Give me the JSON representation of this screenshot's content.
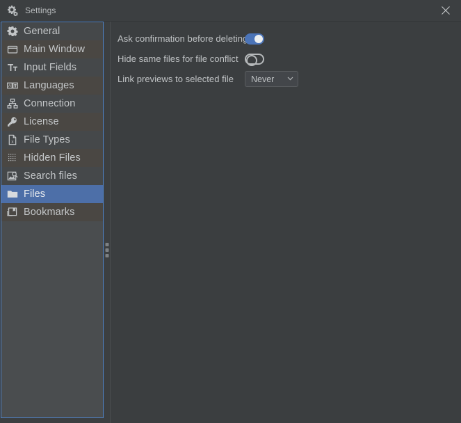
{
  "window": {
    "title": "Settings",
    "icon": "settings-gears-icon",
    "close_label": "×",
    "accent_color": "#4f81c4",
    "background_color": "#3c3f41",
    "content_background_color": "#3b3e40",
    "selection_color": "#4d6fa8",
    "text_color": "#c3c6c8"
  },
  "sidebar": {
    "items": [
      {
        "label": "General",
        "icon": "gear-icon",
        "selected": false
      },
      {
        "label": "Main Window",
        "icon": "window-icon",
        "selected": false
      },
      {
        "label": "Input Fields",
        "icon": "text-cursor-icon",
        "selected": false
      },
      {
        "label": "Languages",
        "icon": "languages-icon",
        "selected": false
      },
      {
        "label": "Connection",
        "icon": "network-icon",
        "selected": false
      },
      {
        "label": "License",
        "icon": "key-icon",
        "selected": false
      },
      {
        "label": "File Types",
        "icon": "file-x-icon",
        "selected": false
      },
      {
        "label": "Hidden Files",
        "icon": "dotted-grid-icon",
        "selected": false
      },
      {
        "label": "Search files",
        "icon": "image-search-icon",
        "selected": false
      },
      {
        "label": "Files",
        "icon": "folder-icon",
        "selected": true
      },
      {
        "label": "Bookmarks",
        "icon": "bookmarks-icon",
        "selected": false
      }
    ]
  },
  "splitter": {
    "icon": "drag-grip-icon"
  },
  "settings": {
    "rows": [
      {
        "label": "Ask confirmation before deleting",
        "control": "toggle",
        "state": "on",
        "name": "ask-confirmation-before-deleting-toggle"
      },
      {
        "label": "Hide same files for file conflict",
        "control": "toggle",
        "state": "off",
        "name": "hide-same-files-for-file-conflict-toggle"
      },
      {
        "label": "Link previews to selected file",
        "control": "select",
        "value": "Never",
        "options": [
          "Never"
        ],
        "name": "link-previews-to-selected-file-select"
      }
    ]
  }
}
